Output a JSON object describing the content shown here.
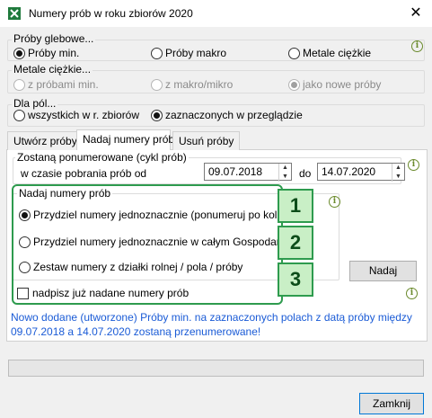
{
  "window": {
    "title": "Numery prób w roku zbiorów 2020",
    "close": "✕"
  },
  "proby_glebowe": {
    "legend": "Próby glebowe...",
    "options": [
      "Próby min.",
      "Próby makro",
      "Metale ciężkie"
    ]
  },
  "metale": {
    "legend": "Metale ciężkie...",
    "options": [
      "z próbami min.",
      "z makro/mikro",
      "jako nowe próby"
    ]
  },
  "dla_pol": {
    "legend": "Dla pól...",
    "options": [
      "wszystkich w r. zbiorów",
      "zaznaczonych w przeglądzie"
    ]
  },
  "tabs": [
    "Utwórz próby",
    "Nadaj numery prób",
    "Usuń próby"
  ],
  "cykl": {
    "legend": "Zostaną ponumerowane (cykl prób)",
    "label": "w czasie pobrania prób od",
    "from": "09.07.2018",
    "do_label": "do",
    "to": "14.07.2020"
  },
  "nadaj": {
    "legend": "Nadaj numery prób",
    "options": [
      "Przydziel numery jednoznacznie (ponumeruj po kolei)",
      "Przydziel numery jednoznacznie w całym Gospodarstwo",
      "Zestaw numery z działki rolnej / pola / próby"
    ],
    "checkbox": "nadpisz już nadane numery prób",
    "button": "Nadaj"
  },
  "badges": [
    "1",
    "2",
    "3"
  ],
  "message": "Nowo dodane (utworzone) Próby min. na zaznaczonych polach z datą próby między 09.07.2018 a 14.07.2020 zostaną przenumerowane!",
  "close_button": "Zamknij",
  "info_glyph": "i",
  "spin": {
    "up": "▲",
    "down": "▼"
  },
  "colors": {
    "accent_green": "#2e9b4e",
    "message_blue": "#1a5bd6"
  }
}
